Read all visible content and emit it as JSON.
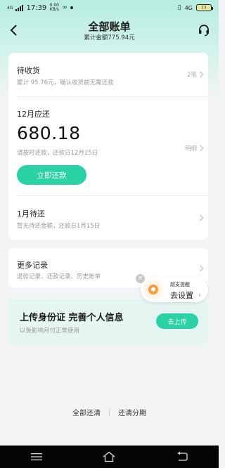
{
  "status_bar": {
    "signal": "4G",
    "time": "17:39",
    "speed": "0.00 KB/s",
    "network": "4G",
    "battery": "77"
  },
  "header": {
    "title": "全部账单",
    "subtitle": "累计金额775.94元"
  },
  "pending_receipt": {
    "label": "待收货",
    "sub": "累计 95.76元，确认收货前无需还款",
    "count": "2笔"
  },
  "december": {
    "label": "12月应还",
    "amount": "680.18",
    "sub": "请按时还款，还款日12月15日",
    "detail": "明细",
    "pay_button": "立即还款"
  },
  "january": {
    "label": "1月待还",
    "sub": "暂无待还金额，还款日1月15日"
  },
  "records": {
    "label": "更多记录",
    "sub": "退款记录、还款记录、历史账单"
  },
  "reminder": {
    "small": "超支提醒",
    "big": "去设置"
  },
  "upload": {
    "title": "上传身份证 完善个人信息",
    "sub": "以免影响月付正常使用",
    "button": "去上传"
  },
  "footer": {
    "left": "全部还清",
    "right": "还清分期"
  },
  "colors": {
    "accent": "#2ad2a6",
    "header_gradient": "#b5ede0"
  }
}
